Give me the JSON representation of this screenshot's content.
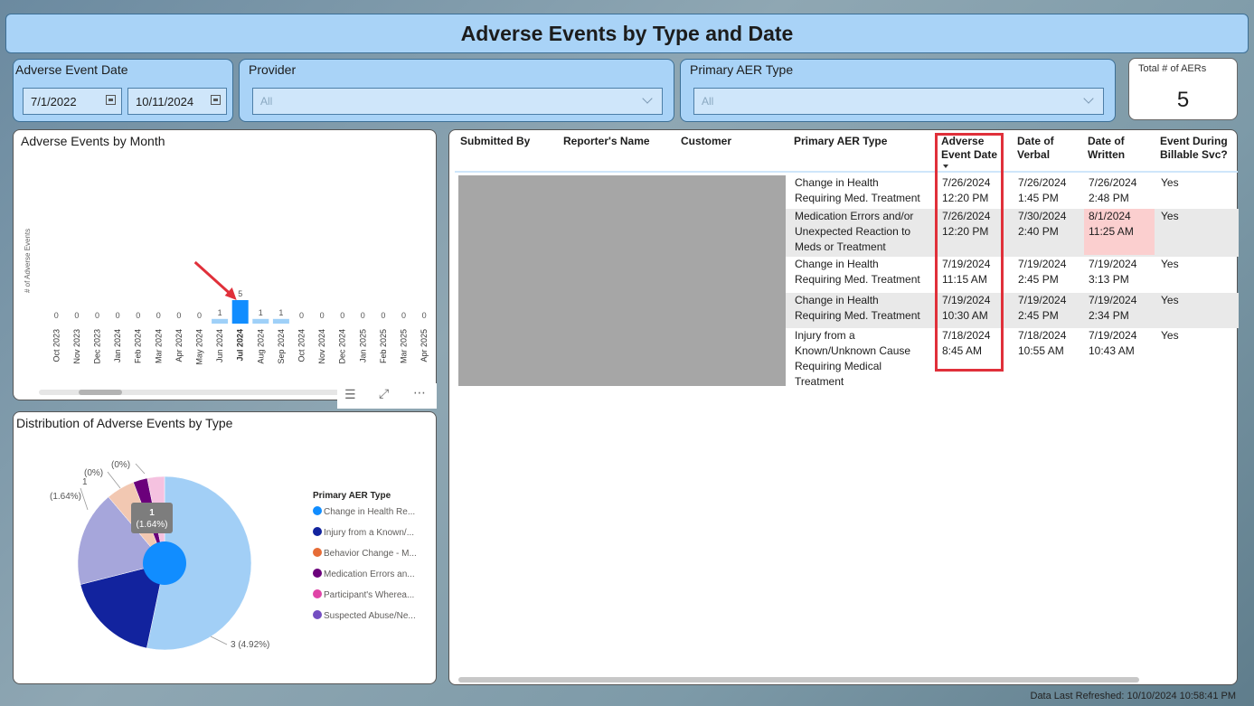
{
  "title": "Adverse Events by Type and Date",
  "filters": {
    "date": {
      "label": "Adverse Event Date",
      "start": "7/1/2022",
      "end": "10/11/2024"
    },
    "provider": {
      "label": "Provider",
      "value": "All"
    },
    "aer_type": {
      "label": "Primary AER Type",
      "value": "All"
    }
  },
  "card": {
    "label": "Total # of AERs",
    "value": "5"
  },
  "bar_panel": {
    "title": "Adverse Events by Month"
  },
  "pie_panel": {
    "title": "Distribution of Adverse Events by Type"
  },
  "chart_data": [
    {
      "type": "bar",
      "title": "Adverse Events by Month",
      "ylabel": "# of Adverse Events",
      "xlabel": "",
      "categories": [
        "Oct 2023",
        "Nov 2023",
        "Dec 2023",
        "Jan 2024",
        "Feb 2024",
        "Mar 2024",
        "Apr 2024",
        "May 2024",
        "Jun 2024",
        "Jul 2024",
        "Aug 2024",
        "Sep 2024",
        "Oct 2024",
        "Nov 2024",
        "Dec 2024",
        "Jan 2025",
        "Feb 2025",
        "Mar 2025",
        "Apr 2025"
      ],
      "values": [
        0,
        0,
        0,
        0,
        0,
        0,
        0,
        0,
        1,
        5,
        1,
        1,
        0,
        0,
        0,
        0,
        0,
        0,
        0
      ],
      "highlighted_category": "Jul 2024",
      "colors": {
        "highlight": "#118dff",
        "normal": "#9fd0f8",
        "arrow": "#e0303a"
      }
    },
    {
      "type": "pie",
      "title": "Distribution of Adverse Events by Type",
      "legend_title": "Primary AER Type",
      "legend_placement": "right",
      "slices": [
        {
          "name": "Change in Health Re...",
          "value": 3,
          "label": "3 (4.92%)",
          "color": "#a2cff6"
        },
        {
          "name": "Injury from a Known/...",
          "value": 1,
          "label": "1 (1.64%)",
          "color": "#12239e"
        },
        {
          "name": "Behavior Change - M...",
          "value": 0.3,
          "label": "(0%)",
          "color": "#f2c8b2"
        },
        {
          "name": "Medication Errors an...",
          "value": 0.15,
          "label": "(0%)",
          "color": "#6b007b"
        },
        {
          "name": "Participant's Wherea...",
          "value": 0.18,
          "label": "",
          "color": "#f5c2e0"
        },
        {
          "name": "Suspected Abuse/Ne...",
          "value": 1,
          "label": "1 (1.64%)",
          "color": "#a6a6db"
        }
      ],
      "legend_colors": [
        "#118dff",
        "#12239e",
        "#e66c37",
        "#6b007b",
        "#e044a7",
        "#744ec2"
      ],
      "inner_label": "1",
      "inner_label_2": "(1.64%)"
    }
  ],
  "table": {
    "headers": [
      "Submitted By",
      "Reporter's Name",
      "Customer",
      "Primary AER Type",
      "Adverse\nEvent Date",
      "Date of\nVerbal",
      "Date of\nWritten",
      "Event During\nBillable Svc?"
    ],
    "rows": [
      {
        "type": [
          "Change in Health",
          "Requiring Med. Treatment"
        ],
        "event": [
          "7/26/2024",
          "12:20 PM"
        ],
        "verbal": [
          "7/26/2024",
          "1:45 PM"
        ],
        "written": [
          "7/26/2024",
          "2:48 PM"
        ],
        "billable": "Yes"
      },
      {
        "type": [
          "Medication Errors and/or",
          "Unexpected Reaction to",
          "Meds or Treatment"
        ],
        "event": [
          "7/26/2024",
          "12:20 PM"
        ],
        "verbal": [
          "7/30/2024",
          "2:40 PM"
        ],
        "written": [
          "8/1/2024",
          "11:25 AM"
        ],
        "billable": "Yes"
      },
      {
        "type": [
          "Change in Health",
          "Requiring Med. Treatment"
        ],
        "event": [
          "7/19/2024",
          "11:15 AM"
        ],
        "verbal": [
          "7/19/2024",
          "2:45 PM"
        ],
        "written": [
          "7/19/2024",
          "3:13 PM"
        ],
        "billable": "Yes"
      },
      {
        "type": [
          "Change in Health",
          "Requiring Med. Treatment"
        ],
        "event": [
          "7/19/2024",
          "10:30 AM"
        ],
        "verbal": [
          "7/19/2024",
          "2:45 PM"
        ],
        "written": [
          "7/19/2024",
          "2:34 PM"
        ],
        "billable": "Yes"
      },
      {
        "type": [
          "Injury from a",
          "Known/Unknown Cause",
          "Requiring Medical",
          "Treatment"
        ],
        "event": [
          "7/18/2024",
          "8:45 AM"
        ],
        "verbal": [
          "7/18/2024",
          "10:55 AM"
        ],
        "written": [
          "7/19/2024",
          "10:43 AM"
        ],
        "billable": "Yes"
      }
    ]
  },
  "footer": "Data Last Refreshed: 10/10/2024 10:58:41 PM"
}
